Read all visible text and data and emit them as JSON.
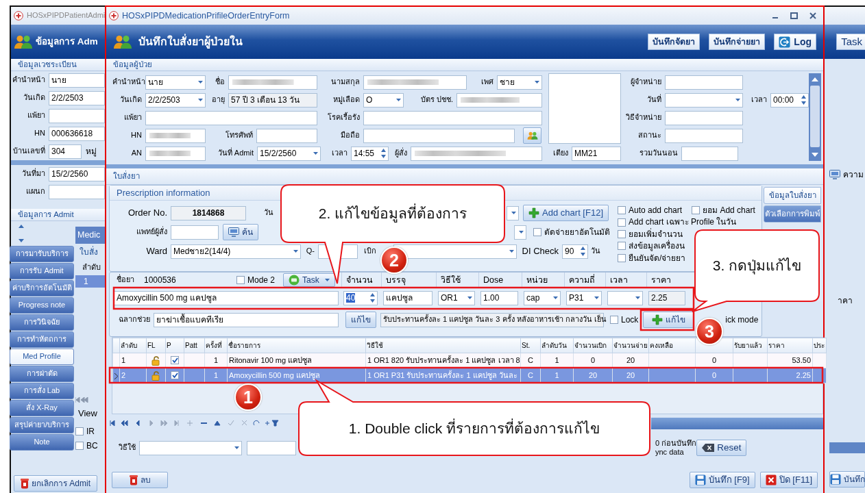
{
  "background_window": {
    "title": "HOSxPIPDPatientAdmi",
    "header": "ข้อมูลการ Adm",
    "task_button": "Task",
    "record_section": "ข้อมูลเวชระเบียน",
    "record_fields": [
      {
        "label": "คำนำหน้า",
        "value": "นาย"
      },
      {
        "label": "วันเกิด",
        "value": "2/2/2503"
      },
      {
        "label": "แพ้ยา"
      },
      {
        "label": "HN",
        "value": "000636618"
      },
      {
        "label": "บ้านเลขที่",
        "value": "304",
        "extra_label": "หมู่"
      }
    ],
    "visit_fields": [
      {
        "label": "วันที่มา",
        "value": "15/2/2560"
      },
      {
        "label": "แผนก"
      }
    ],
    "admit_section": "ข้อมูลการ Admit",
    "nav_buttons": [
      {
        "label": "การมารับบริการ",
        "selected": false
      },
      {
        "label": "การรับ Admit",
        "selected": false
      },
      {
        "label": "ค่าบริการอัตโนมัติ",
        "selected": false
      },
      {
        "label": "Progress note",
        "selected": false
      },
      {
        "label": "การวินิจฉัย",
        "selected": false
      },
      {
        "label": "การทำหัตถการ",
        "selected": false
      },
      {
        "label": "Med Profile",
        "selected": true
      },
      {
        "label": "การผ่าตัด",
        "selected": false
      },
      {
        "label": "การสั่ง Lab",
        "selected": false
      },
      {
        "label": "สั่ง X-Ray",
        "selected": false
      },
      {
        "label": "สรุปค่ายา/บริการ",
        "selected": false
      },
      {
        "label": "Note",
        "selected": false
      }
    ],
    "tab": "Medic",
    "subtab": "ใบสั่ง",
    "grid_column": "ลำดับ",
    "grid_row": "1",
    "view_tab": "View",
    "view_options": [
      {
        "label": "IR",
        "checked": false
      },
      {
        "label": "BC",
        "checked": false
      }
    ],
    "cancel_button": "ยกเลิกการ Admit",
    "side_label": "ความ",
    "side_column": "าคา",
    "save_button": "บันทึก"
  },
  "window": {
    "title": "HOSxPIPDMedicationPrifileOrderEntryForm",
    "header": "บันทึกใบสั่งยาผู้ป่วยใน",
    "header_buttons": [
      {
        "label": "บันทึกจัดยา",
        "kind": "plain"
      },
      {
        "label": "บันทึกจ่ายยา",
        "kind": "plain"
      },
      {
        "label": "Log",
        "kind": "log"
      }
    ]
  },
  "patient": {
    "section": "ข้อมูลผู้ป่วย",
    "fields": [
      {
        "label": "คำนำหน้า",
        "value": "นาย",
        "kind": "combo"
      },
      {
        "label": "ชื่อ",
        "kind": "blurred"
      },
      {
        "label": "นามสกุล",
        "kind": "blurred"
      },
      {
        "label": "เพศ",
        "value": "ชาย",
        "kind": "combo"
      },
      {
        "label": "วันเกิด",
        "value": "2/2/2503",
        "kind": "combo"
      },
      {
        "label": "อายุ",
        "value": "57 ปี 3 เดือน 13 วัน",
        "kind": "readonly"
      },
      {
        "label": "หมู่เลือด",
        "value": "O",
        "kind": "combo"
      },
      {
        "label": "บัตร ปชช.",
        "kind": "blurred"
      },
      {
        "label": "แพ้ยา",
        "kind": "text"
      },
      {
        "label": "โรคเรื้อรัง",
        "kind": "text"
      },
      {
        "label": "HN",
        "kind": "blurred"
      },
      {
        "label": "โทรศัพท์",
        "kind": "text"
      },
      {
        "label": "มือถือ",
        "kind": "lookup"
      },
      {
        "label": "AN",
        "kind": "blurred"
      },
      {
        "label": "วันที่ Admit",
        "value": "15/2/2560",
        "kind": "combo"
      },
      {
        "label": "เวลา",
        "value": "14:55",
        "kind": "spin"
      },
      {
        "label": "ผู้สั่ง",
        "kind": "blurred"
      }
    ],
    "bed": {
      "label": "เตียง",
      "value": "MM21",
      "kind": "text"
    },
    "discharge_fields": [
      {
        "label": "ผู้จำหน่าย",
        "kind": "text"
      },
      {
        "label": "วันที่",
        "kind": "combo"
      },
      {
        "label": "เวลา",
        "value": "00:00",
        "kind": "spin"
      },
      {
        "label": "วิธีจำหน่าย",
        "kind": "text"
      },
      {
        "label": "สถานะ",
        "kind": "text"
      },
      {
        "label": "รวมวันนอน",
        "kind": "text"
      }
    ]
  },
  "prescription": {
    "section": "ใบสั่งยา",
    "group_title": "Prescription information",
    "order_no": {
      "label": "Order No.",
      "value": "1814868"
    },
    "date_label": "วัน",
    "add_chart_button": "Add chart [F12]",
    "doctor": {
      "label": "แพทย์ผู้สั่ง"
    },
    "search_button": "ค้น",
    "auto_cut": {
      "label": "ตัดจ่ายยาอัตโนมัติ",
      "checked": false
    },
    "ward": {
      "label": "Ward",
      "value": "Medชาย2(14/4)"
    },
    "q_label": "Q-",
    "withdraw_label": "เบิก",
    "di_check": {
      "label": "DI Check",
      "value": "90",
      "unit": "วัน"
    },
    "options": [
      {
        "label": "Auto add chart",
        "checked": false
      },
      {
        "label": "ยอม Add chart",
        "checked": false
      },
      {
        "label": "Add chart เฉพาะ Profile ในวัน",
        "checked": false
      },
      {
        "label": "ยอมเพิ่มจำนวน",
        "checked": false
      },
      {
        "label": "ส่งข้อมูลเครื่องน",
        "checked": false
      },
      {
        "label": "ยืนยันจัด/จ่ายยา",
        "checked": false
      }
    ],
    "side_tabs": [
      {
        "label": "ข้อมูลใบสั่งยา",
        "selected": true
      },
      {
        "label": "ตัวเลือกการพิมพ์",
        "selected": false
      }
    ]
  },
  "drug_entry": {
    "drug_label": "ชื่อยา",
    "drug_code": "1000536",
    "mode2": {
      "label": "Mode 2",
      "checked": false
    },
    "task_button": "Task",
    "columns": [
      "จำนวน",
      "บรรจุ",
      "วิธีใช้",
      "Dose",
      "หน่วย",
      "ความถี่",
      "เวลา",
      "ราคา"
    ],
    "drug_name": "Amoxycillin 500 mg แคปซูล",
    "values": [
      {
        "value": "40",
        "kind": "spin",
        "text_selected": true
      },
      {
        "value": "แคปซูล",
        "kind": "text"
      },
      {
        "value": "OR1",
        "kind": "combo"
      },
      {
        "value": "1.00",
        "kind": "text"
      },
      {
        "value": "cap",
        "kind": "combo"
      },
      {
        "value": "P31",
        "kind": "combo"
      },
      {
        "kind": "combo"
      },
      {
        "value": "2.25",
        "kind": "readonly"
      }
    ],
    "aux": {
      "label": "ฉลากช่วย",
      "value": "ยาฆ่าเชื้อแบคทีเรีย"
    },
    "usage_edit_button": "แก้ไข",
    "usage_text": "รับประทานครั้งละ 1 แคปซูล วันละ 3 ครั้ง หลังอาหารเช้า กลางวัน เย็น",
    "lock": {
      "label": "Lock",
      "checked": false
    },
    "edit_button": "แก้ไข",
    "quick_mode_label": "ick mode"
  },
  "order_grid": {
    "columns": [
      "ลำดับ",
      "FL",
      "P",
      "Patt",
      "ครั้งที่",
      "ชื่อรายการ",
      "วิธีใช้",
      "St.",
      "ลำดับวัน",
      "จำนวนเบิก",
      "จำนวนจ่าย",
      "คงเหลือ",
      null,
      "รับยาแล้ว",
      "ราคา",
      "ประ"
    ],
    "rows": [
      {
        "selected": false,
        "no": "1",
        "p_checked": true,
        "times": "1",
        "item": "Ritonavir 100 mg แคปซูล",
        "usage": "1 OR1 820  รับประทานครั้งละ 1 แคปซูล เวลา 8",
        "st": "C",
        "day_order": "1",
        "requested": "0",
        "dispensed": "20",
        "column_13": "0",
        "price": "53.50"
      },
      {
        "selected": true,
        "no": "2",
        "p_checked": true,
        "times": "1",
        "item": "Amoxycillin 500 mg แคปซูล",
        "usage": "1 OR1 P31  รับประทานครั้งละ 1 แคปซูล วันละ",
        "st": "C",
        "day_order": "1",
        "requested": "20",
        "dispensed": "20",
        "column_13": "0",
        "price": "2.25"
      }
    ]
  },
  "bottom": {
    "usage_label": "วิธีใช้",
    "note_fragment": "0 ก่อนบันทึก",
    "sync_fragment": "ync data",
    "reset_button": "Reset",
    "delete_button": "ลบ",
    "save_button": "บันทึก [F9]",
    "close_button": "ปิด [F11]"
  },
  "callouts": [
    {
      "badge": "2",
      "text": "2. แก้ไขข้อมูลที่ต้องการ"
    },
    {
      "badge": "3",
      "text": "3. กดปุ่มแก้ไข"
    },
    {
      "badge": "1",
      "text": "1. Double click ที่รายการที่ต้องการแก้ไข"
    }
  ]
}
